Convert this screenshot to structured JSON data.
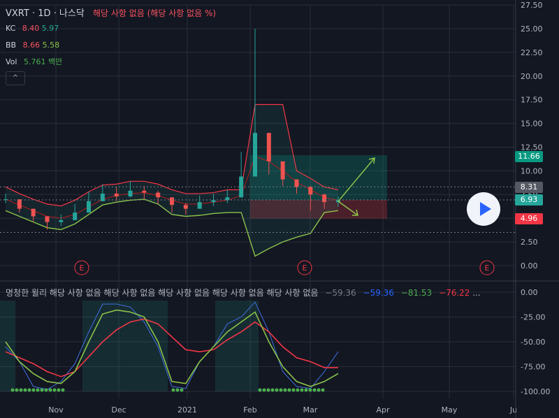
{
  "header": {
    "symbol": "VXRT · 1D · 나스닥",
    "status_msg": "해당 사항 없음 (해당 사항 없음 %)",
    "kc_label": "KC",
    "kc_v1": "8.40",
    "kc_v2": "5.97",
    "bb_label": "BB",
    "bb_v1": "8.66",
    "bb_v2": "5.58",
    "vol_label": "Vol",
    "vol_v": "5.761 백만",
    "collapse": "^"
  },
  "indicator": {
    "name": "명청한 윌리",
    "na": "해당 사항 없음 해당 사항 없음 해당 사항 없음 해당 사항 없음 해당 사항 없음",
    "v1": "−59.36",
    "v2": "−59.36",
    "v3": "−81.53",
    "v4": "−76.22",
    "dots": "..."
  },
  "price_tags": [
    {
      "label": "11.66",
      "color": "#089981"
    },
    {
      "label": "8.31",
      "color": "#555963"
    },
    {
      "label": "6.93",
      "color": "#26a69a"
    },
    {
      "label": "4.96",
      "color": "#f23645"
    }
  ],
  "colors": {
    "up": "#26a69a",
    "down": "#ef5350",
    "bg": "#131722",
    "grid": "#2a2e39",
    "bb_upper": "#f23645",
    "bb_lower": "#8bc34a",
    "kc_mid": "#ff5252"
  },
  "chart_data": [
    {
      "type": "candlestick",
      "title": "VXRT",
      "ylim": [
        -0.5,
        27.5
      ],
      "y_ticks": [
        "27.50",
        "25.00",
        "22.50",
        "20.00",
        "17.50",
        "15.00",
        "12.50",
        "10.00",
        "7.50",
        "5.00",
        "2.50",
        "0.00"
      ],
      "x_tick_labels": [
        "Nov",
        "Dec",
        "2021",
        "Feb",
        "Mar",
        "Apr",
        "May",
        "Ju"
      ],
      "earnings_markers": [
        "E",
        "E",
        "E"
      ],
      "x": [
        "2020-10-01",
        "2020-10-08",
        "2020-10-15",
        "2020-10-22",
        "2020-10-29",
        "2020-11-05",
        "2020-11-12",
        "2020-11-19",
        "2020-11-26",
        "2020-12-03",
        "2020-12-10",
        "2020-12-17",
        "2020-12-24",
        "2020-12-31",
        "2021-01-07",
        "2021-01-14",
        "2021-01-21",
        "2021-01-28",
        "2021-02-01",
        "2021-02-04",
        "2021-02-11",
        "2021-02-18",
        "2021-02-25",
        "2021-03-04",
        "2021-03-11"
      ],
      "close": [
        7.0,
        6.0,
        5.2,
        4.6,
        4.8,
        5.6,
        6.8,
        7.6,
        7.3,
        7.9,
        7.7,
        7.2,
        6.4,
        6.0,
        6.7,
        6.9,
        7.2,
        9.4,
        14.0,
        11.0,
        9.1,
        8.3,
        7.5,
        6.7,
        6.9
      ],
      "high": [
        7.6,
        6.6,
        5.8,
        5.2,
        5.4,
        6.5,
        7.8,
        8.6,
        8.3,
        8.9,
        8.4,
        7.9,
        7.0,
        6.6,
        7.4,
        7.6,
        8.0,
        12.0,
        25.0,
        13.0,
        10.2,
        9.1,
        8.4,
        7.6,
        7.3
      ],
      "low": [
        6.6,
        5.6,
        4.7,
        3.8,
        4.2,
        5.0,
        5.9,
        7.0,
        6.8,
        7.2,
        7.0,
        6.5,
        5.6,
        5.4,
        6.0,
        6.3,
        6.6,
        7.8,
        10.0,
        9.6,
        8.4,
        7.6,
        5.8,
        6.0,
        6.2
      ],
      "bb_upper": [
        8.3,
        7.6,
        7.0,
        6.5,
        6.3,
        6.9,
        7.8,
        8.5,
        8.6,
        8.9,
        8.9,
        8.6,
        8.0,
        7.6,
        7.6,
        7.7,
        8.0,
        8.0,
        17.0,
        17.0,
        17.0,
        10.0,
        9.2,
        8.3,
        8.0
      ],
      "bb_lower": [
        5.8,
        5.2,
        4.6,
        4.0,
        3.8,
        4.4,
        5.4,
        6.4,
        6.7,
        6.9,
        7.0,
        6.5,
        5.4,
        5.2,
        5.3,
        5.5,
        5.6,
        5.6,
        1.0,
        1.8,
        2.5,
        3.0,
        3.4,
        5.6,
        5.8
      ],
      "ma": [
        7.0,
        6.4,
        5.8,
        5.2,
        5.0,
        5.4,
        6.2,
        7.0,
        7.4,
        7.6,
        7.7,
        7.4,
        6.9,
        6.5,
        6.5,
        6.7,
        6.9,
        7.4,
        11.5,
        11.0,
        10.0,
        8.8,
        8.0,
        7.2,
        6.9
      ],
      "projection": {
        "entry": 6.93,
        "target": 11.66,
        "stop": 4.96,
        "current": 8.31
      }
    },
    {
      "type": "line",
      "title": "명청한 윌리",
      "ylim": [
        -105,
        0
      ],
      "y_ticks": [
        "0.00",
        "-25.00",
        "-50.00",
        "-75.00",
        "-100.00"
      ],
      "series": [
        {
          "name": "",
          "values": [
            -55,
            -70,
            -95,
            -98,
            -90,
            -72,
            -40,
            -12,
            -12,
            -15,
            -30,
            -55,
            -95,
            -97,
            -70,
            -55,
            -32,
            -25,
            -10,
            -40,
            -80,
            -95,
            -97,
            -80,
            -60
          ]
        },
        {
          "name": "",
          "values": [
            -60,
            -66,
            -72,
            -80,
            -85,
            -80,
            -65,
            -50,
            -38,
            -30,
            -27,
            -32,
            -45,
            -58,
            -60,
            -58,
            -48,
            -40,
            -30,
            -40,
            -55,
            -66,
            -70,
            -76,
            -76
          ]
        },
        {
          "name": "",
          "values": [
            -50,
            -70,
            -82,
            -90,
            -92,
            -80,
            -50,
            -22,
            -18,
            -20,
            -25,
            -50,
            -90,
            -92,
            -70,
            -55,
            -40,
            -30,
            -20,
            -50,
            -75,
            -90,
            -95,
            -90,
            -82
          ]
        }
      ]
    }
  ]
}
